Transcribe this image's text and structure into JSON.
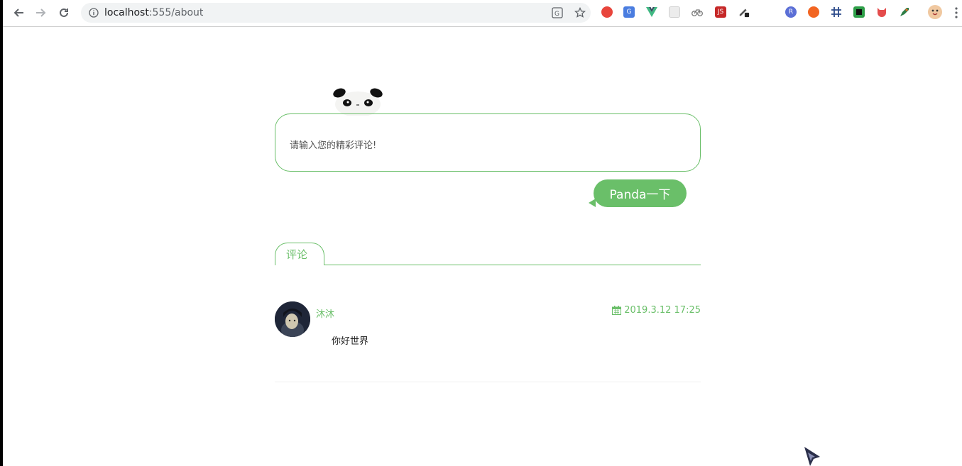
{
  "browser": {
    "url_host": "localhost",
    "url_path": ":555/about",
    "extensions": [
      {
        "name": "extension-red-circle",
        "color": "#e8453c"
      },
      {
        "name": "extension-google-translate",
        "color": "#4a7de0"
      },
      {
        "name": "extension-vue-devtools",
        "color": "#41b883"
      },
      {
        "name": "extension-grid",
        "color": "#cfcfcf"
      },
      {
        "name": "extension-bike",
        "color": "#777777"
      },
      {
        "name": "extension-js",
        "color": "#c62828"
      },
      {
        "name": "extension-eyedropper",
        "color": "#555555"
      },
      {
        "name": "extension-react",
        "color": "#5b6fd6"
      },
      {
        "name": "extension-orange-circle",
        "color": "#f26522"
      },
      {
        "name": "extension-hash",
        "color": "#2c4a8a"
      },
      {
        "name": "extension-green-square",
        "color": "#2e9e48"
      },
      {
        "name": "extension-octocat",
        "color": "#e44c4c"
      },
      {
        "name": "extension-rocket",
        "color": "#2d7d46"
      },
      {
        "name": "profile-avatar",
        "color": "#f0c8a0"
      }
    ]
  },
  "comment_form": {
    "placeholder": "请输入您的精彩评论!",
    "submit_label": "Panda一下"
  },
  "tabs": {
    "active": "评论"
  },
  "comments": [
    {
      "username": "沐沐",
      "date": "2019.3.12 17:25",
      "text": "你好世界"
    }
  ],
  "colors": {
    "accent": "#6abf69"
  }
}
